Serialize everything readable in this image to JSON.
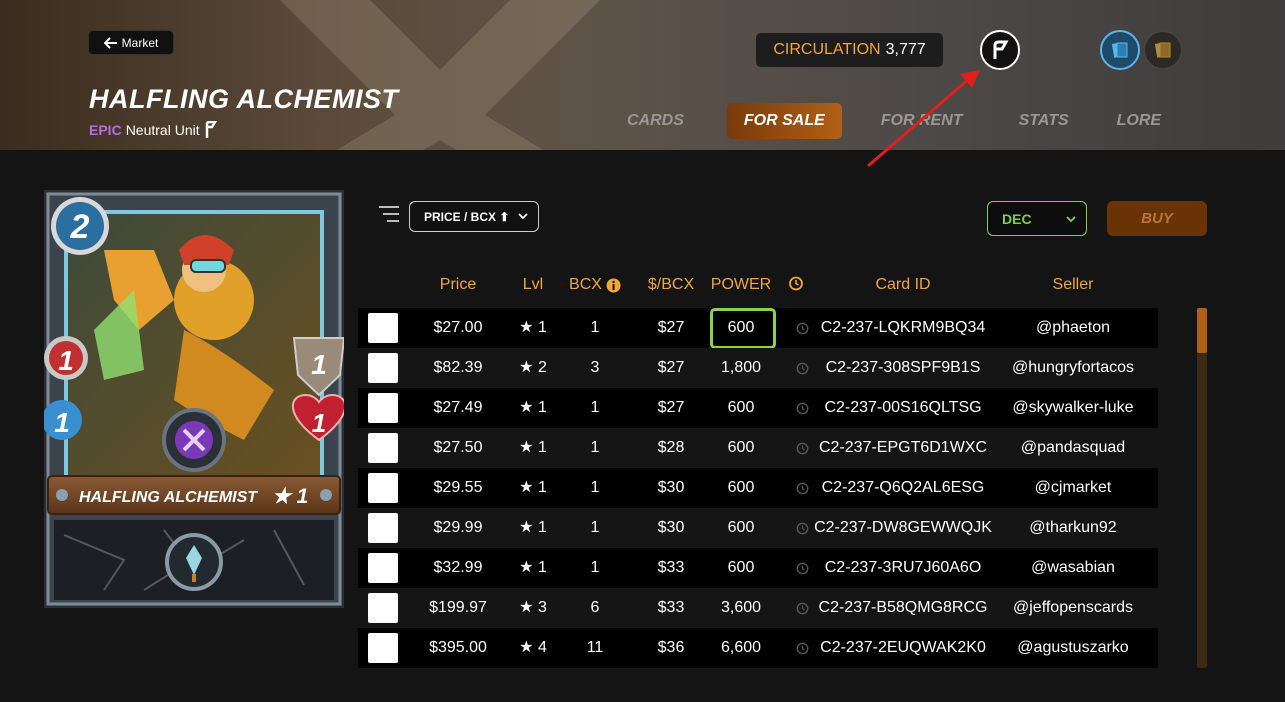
{
  "header": {
    "back_label": "Market",
    "title": "HALFLING ALCHEMIST",
    "rarity": "EPIC",
    "unit_type": "Neutral Unit",
    "circulation_label": "CIRCULATION",
    "circulation_value": "3,777",
    "tabs": [
      {
        "label": "CARDS",
        "active": false
      },
      {
        "label": "FOR SALE",
        "active": true
      },
      {
        "label": "FOR RENT",
        "active": false
      },
      {
        "label": "STATS",
        "active": false
      },
      {
        "label": "LORE",
        "active": false
      }
    ]
  },
  "card": {
    "name": "HALFLING ALCHEMIST",
    "level_star": "★ 1",
    "mana": "2",
    "attack": "1",
    "speed": "1",
    "armor": "1",
    "health": "1",
    "colors": {
      "frame": "#7ec8e0",
      "mana": "#2a6fa0",
      "attack": "#c03030",
      "speed": "#3a8fd0",
      "armor": "#9a8a7a",
      "health": "#c02030"
    }
  },
  "toolbar": {
    "sort_label": "PRICE / BCX ⬆",
    "currency": "DEC",
    "buy_label": "BUY"
  },
  "table": {
    "headers": [
      "Price",
      "Lvl",
      "BCX",
      "$/BCX",
      "POWER",
      "Card ID",
      "Seller"
    ],
    "rows": [
      {
        "price": "$27.00",
        "lvl": "★ 1",
        "bcx": "1",
        "per_bcx": "$27",
        "power": "600",
        "card_id": "C2-237-LQKRM9BQ34",
        "seller": "@phaeton"
      },
      {
        "price": "$82.39",
        "lvl": "★ 2",
        "bcx": "3",
        "per_bcx": "$27",
        "power": "1,800",
        "card_id": "C2-237-308SPF9B1S",
        "seller": "@hungryfortacos"
      },
      {
        "price": "$27.49",
        "lvl": "★ 1",
        "bcx": "1",
        "per_bcx": "$27",
        "power": "600",
        "card_id": "C2-237-00S16QLTSG",
        "seller": "@skywalker-luke"
      },
      {
        "price": "$27.50",
        "lvl": "★ 1",
        "bcx": "1",
        "per_bcx": "$28",
        "power": "600",
        "card_id": "C2-237-EPGT6D1WXC",
        "seller": "@pandasquad"
      },
      {
        "price": "$29.55",
        "lvl": "★ 1",
        "bcx": "1",
        "per_bcx": "$30",
        "power": "600",
        "card_id": "C2-237-Q6Q2AL6ESG",
        "seller": "@cjmarket"
      },
      {
        "price": "$29.99",
        "lvl": "★ 1",
        "bcx": "1",
        "per_bcx": "$30",
        "power": "600",
        "card_id": "C2-237-DW8GEWWQJK",
        "seller": "@tharkun92"
      },
      {
        "price": "$32.99",
        "lvl": "★ 1",
        "bcx": "1",
        "per_bcx": "$33",
        "power": "600",
        "card_id": "C2-237-3RU7J60A6O",
        "seller": "@wasabian"
      },
      {
        "price": "$199.97",
        "lvl": "★ 3",
        "bcx": "6",
        "per_bcx": "$33",
        "power": "3,600",
        "card_id": "C2-237-B58QMG8RCG",
        "seller": "@jeffopenscards"
      },
      {
        "price": "$395.00",
        "lvl": "★ 4",
        "bcx": "11",
        "per_bcx": "$36",
        "power": "6,600",
        "card_id": "C2-237-2EUQWAK2K0",
        "seller": "@agustuszarko"
      }
    ]
  },
  "colors": {
    "accent": "#f2a53a",
    "highlight": "#8ed14e",
    "buy": "#6a3305",
    "rarity_epic": "#b96be6"
  },
  "icons": [
    "back-arrow-icon",
    "edition-icon",
    "card-view-icon",
    "card-back-icon",
    "sort-filter-icon",
    "info-icon",
    "clock-icon",
    "chevron-down-icon"
  ]
}
